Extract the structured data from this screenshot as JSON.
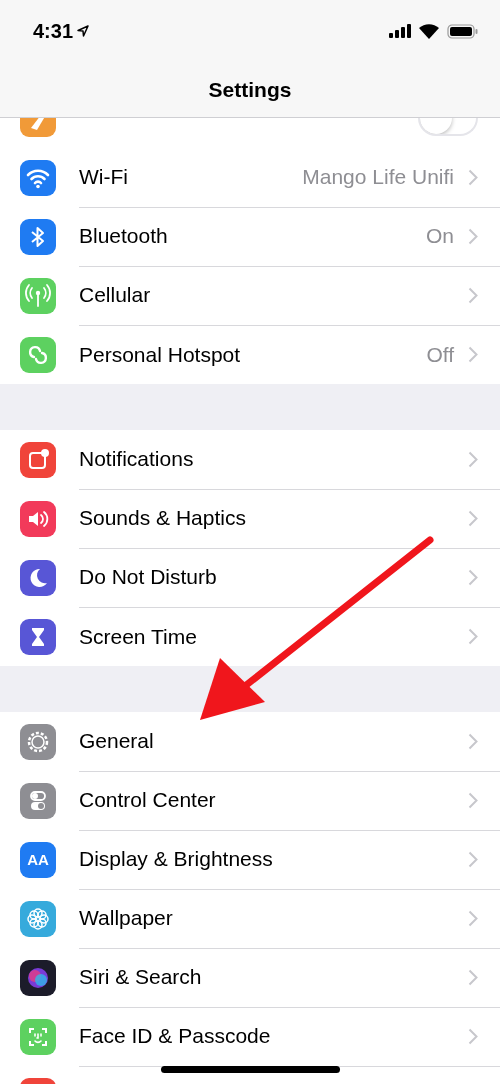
{
  "status_bar": {
    "time": "4:31"
  },
  "nav": {
    "title": "Settings"
  },
  "groups": [
    {
      "rows": [
        {
          "kind": "toggle",
          "on": false
        },
        {
          "kind": "link",
          "label": "Wi-Fi",
          "value": "Mango Life Unifi"
        },
        {
          "kind": "link",
          "label": "Bluetooth",
          "value": "On"
        },
        {
          "kind": "link",
          "label": "Cellular"
        },
        {
          "kind": "link",
          "label": "Personal Hotspot",
          "value": "Off"
        }
      ]
    },
    {
      "rows": [
        {
          "kind": "link",
          "label": "Notifications"
        },
        {
          "kind": "link",
          "label": "Sounds & Haptics"
        },
        {
          "kind": "link",
          "label": "Do Not Disturb"
        },
        {
          "kind": "link",
          "label": "Screen Time"
        }
      ]
    },
    {
      "rows": [
        {
          "kind": "link",
          "label": "General"
        },
        {
          "kind": "link",
          "label": "Control Center"
        },
        {
          "kind": "link",
          "label": "Display & Brightness",
          "icon_text": "AA"
        },
        {
          "kind": "link",
          "label": "Wallpaper"
        },
        {
          "kind": "link",
          "label": "Siri & Search"
        },
        {
          "kind": "link",
          "label": "Face ID & Passcode"
        },
        {
          "kind": "partial"
        }
      ]
    }
  ]
}
